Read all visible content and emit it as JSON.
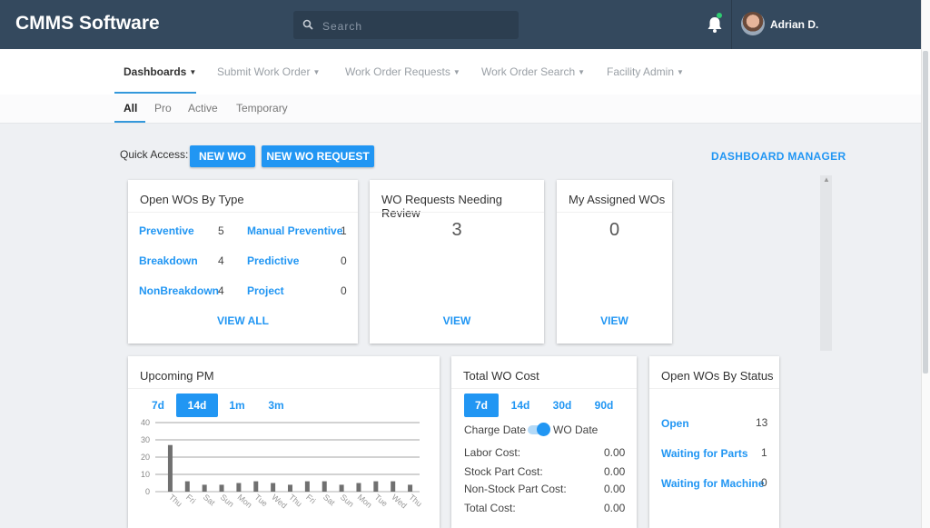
{
  "app": {
    "title": "CMMS Software",
    "user_name": "Adrian D."
  },
  "search": {
    "placeholder": "Search"
  },
  "nav": {
    "items": [
      {
        "label": "Dashboards",
        "active": true
      },
      {
        "label": "Submit Work Order"
      },
      {
        "label": "Work Order Requests"
      },
      {
        "label": "Work Order Search"
      },
      {
        "label": "Facility Admin"
      }
    ]
  },
  "subtabs": [
    "All",
    "Pro",
    "Active",
    "Temporary"
  ],
  "quick_access": {
    "label": "Quick Access:",
    "new_wo": "NEW WO",
    "new_wo_request": "NEW WO REQUEST"
  },
  "dashboard_manager": "DASHBOARD MANAGER",
  "open_wos_by_type": {
    "title": "Open WOs By Type",
    "rows": [
      {
        "label": "Preventive",
        "value": "5",
        "label2": "Manual Preventive",
        "value2": "1"
      },
      {
        "label": "Breakdown",
        "value": "4",
        "label2": "Predictive",
        "value2": "0"
      },
      {
        "label": "NonBreakdown",
        "value": "4",
        "label2": "Project",
        "value2": "0"
      }
    ],
    "view_all": "VIEW ALL"
  },
  "wo_requests": {
    "title": "WO Requests Needing Review",
    "count": "3",
    "view": "VIEW"
  },
  "my_assigned": {
    "title": "My Assigned WOs",
    "count": "0",
    "view": "VIEW"
  },
  "upcoming_pm": {
    "title": "Upcoming PM",
    "ranges": [
      "7d",
      "14d",
      "1m",
      "3m"
    ],
    "selected_range": "14d"
  },
  "total_wo_cost": {
    "title": "Total WO Cost",
    "ranges": [
      "7d",
      "14d",
      "30d",
      "90d"
    ],
    "selected_range": "7d",
    "toggle_left": "Charge Date",
    "toggle_right": "WO Date",
    "rows": [
      {
        "label": "Labor Cost:",
        "value": "0.00"
      },
      {
        "label": "Stock Part Cost:",
        "value": "0.00"
      },
      {
        "label": "Non-Stock Part Cost:",
        "value": "0.00"
      },
      {
        "label": "Total Cost:",
        "value": "0.00"
      }
    ]
  },
  "open_wos_by_status": {
    "title": "Open WOs By Status",
    "rows": [
      {
        "label": "Open",
        "value": "13"
      },
      {
        "label": "Waiting for Parts",
        "value": "1"
      },
      {
        "label": "Waiting for Machine",
        "value": "0"
      }
    ]
  },
  "colors": {
    "header": "#34495e",
    "accent": "#2196f3"
  },
  "chart_data": {
    "type": "bar",
    "categories": [
      "Thu",
      "Fri",
      "Sat",
      "Sun",
      "Mon",
      "Tue",
      "Wed",
      "Thu",
      "Fri",
      "Sat",
      "Sun",
      "Mon",
      "Tue",
      "Wed",
      "Thu"
    ],
    "values": [
      27,
      6,
      4,
      4,
      5,
      6,
      5,
      4,
      6,
      6,
      4,
      5,
      6,
      6,
      4
    ],
    "ylim": [
      0,
      40
    ],
    "yticks": [
      0,
      10,
      20,
      30,
      40
    ],
    "grid": true
  }
}
